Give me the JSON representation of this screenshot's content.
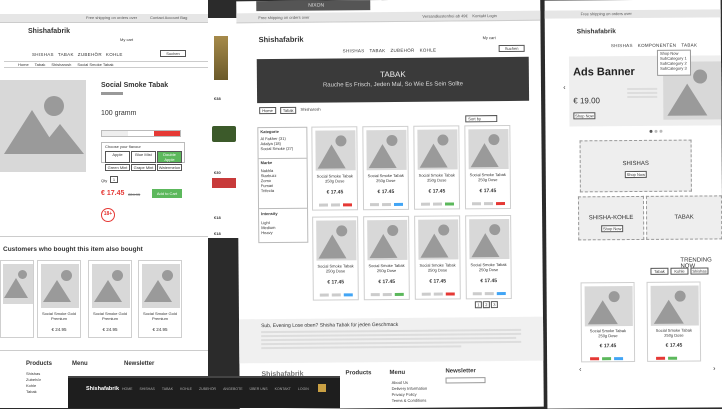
{
  "left": {
    "topbar_text": "Free shipping on orders over",
    "topbar_right": "Contact  Account  Bag",
    "logo": "Shishafabrik",
    "cart": "My cart",
    "nav": [
      "SHISHAS",
      "TABAK",
      "ZUBEHÖR",
      "KOHLE"
    ],
    "search_btn": "Suchen",
    "breadcrumbs": [
      "Home",
      "Tabak",
      "Shisharosh",
      "Social Smoke Tabak"
    ],
    "product_title": "Social Smoke Tabak",
    "weight": "100 gramm",
    "price": "€ 17.45",
    "old_price": "€24.95",
    "add_to_cart": "Add to Cart",
    "age": "18+",
    "qty_label": "Qty",
    "qty": "1",
    "flavour_label": "Choose your flavour",
    "flavours": [
      "Apple",
      "Blue Mist",
      "Double Apple",
      "Green Mint",
      "Grape Mint",
      "Watermelon"
    ],
    "customers_title": "Customers who bought this item also bought",
    "related": [
      {
        "name": "Social Smoke Gold Premium",
        "price": "€ 24.95"
      },
      {
        "name": "Social Smoke Gold Premium",
        "price": "€ 24.95"
      },
      {
        "name": "Social Smoke Gold Premium",
        "price": "€ 24.95"
      },
      {
        "name": "Social Smoke Gold Premium",
        "price": "€ 24.95"
      }
    ],
    "footer_products": "Products",
    "footer_menu": "Menu",
    "footer_newsletter": "Newsletter",
    "footer_links": [
      "Shishas",
      "Zubehör",
      "Kohle",
      "Tabak"
    ]
  },
  "strip": {
    "price_a": "€38",
    "price_b": "€30",
    "price_c": "€18",
    "price_d": "€18"
  },
  "middle": {
    "topbar_text": "Free shipping on orders over",
    "topbar_mid": "Versandkostenfrei ab 49€",
    "topbar_right": "Kontakt  Login",
    "dark_top": "NIXON",
    "logo": "Shishafabrik",
    "cart": "My cart",
    "nav": [
      "SHISHAS",
      "TABAK",
      "ZUBEHÖR",
      "KOHLE"
    ],
    "search_btn": "Suchen",
    "hero_title": "TABAK",
    "hero_sub": "Rauche Es Frisch, Jeden Mal, So Wie Es Sein Sollte",
    "breadcrumbs": [
      "Home",
      "Tabak",
      "Shisharosh"
    ],
    "sort": "Sort by",
    "filter_kategorie": "Kategorie",
    "filter_kat_items": [
      "Al Fakher (31)",
      "Adalya (18)",
      "Social Smoke (27)"
    ],
    "filter_marke": "Marke",
    "filter_marke_items": [
      "Nakhla",
      "Starbuzz",
      "Zomo",
      "Fumari",
      "Trifecta"
    ],
    "filter_intensity": "Intensity",
    "filter_int_items": [
      "Light",
      "Medium",
      "Heavy"
    ],
    "products": [
      {
        "name": "Social Smoke Tabak 250g Dose",
        "price": "€ 17.45"
      },
      {
        "name": "Social Smoke Tabak 250g Dose",
        "price": "€ 17.45"
      },
      {
        "name": "Social Smoke Tabak 250g Dose",
        "price": "€ 17.45"
      },
      {
        "name": "Social Smoke Tabak 250g Dose",
        "price": "€ 17.45"
      },
      {
        "name": "Social Smoke Tabak 250g Dose",
        "price": "€ 17.45"
      },
      {
        "name": "Social Smoke Tabak 250g Dose",
        "price": "€ 17.45"
      },
      {
        "name": "Social Smoke Tabak 250g Dose",
        "price": "€ 17.45"
      },
      {
        "name": "Social Smoke Tabak 250g Dose",
        "price": "€ 17.45"
      }
    ],
    "pages": [
      "1",
      "2",
      "3"
    ],
    "seo_title": "Sub, Evening Lose oben? Shisha Tabak für jeden Geschmack",
    "footer_logo": "Shishafabrik",
    "footer_products": "Products",
    "footer_menu": "Menu",
    "footer_newsletter": "Newsletter",
    "footer_menu_links": [
      "About Us",
      "Delivery Information",
      "Privacy Policy",
      "Terms & Conditions"
    ]
  },
  "right": {
    "topbar_text": "Free shipping on orders over",
    "logo": "Shishafabrik",
    "nav": [
      "SHISHAS",
      "KOMPONENTEN",
      "TABAK"
    ],
    "dropdown": [
      "Shop Now",
      "SubCategory 1",
      "SubCategory 2",
      "SubCategory 3"
    ],
    "banner_title": "Ads Banner",
    "banner_price": "€ 19.00",
    "banner_btn": "Shop Now",
    "tile1": "SHISHAS",
    "tile1_btn": "Shop Now",
    "tile2": "SHISHA-KOHLE",
    "tile2_btn": "Shop Now",
    "tile3": "TABAK",
    "trending": "TRENDING NOW",
    "tabs": [
      "Tabak",
      "Kohle",
      "Shishas"
    ],
    "products": [
      {
        "name": "Social Smoke Tabak 250g Dose",
        "price": "€ 17.45"
      },
      {
        "name": "Social Smoke Tabak 250g Dose",
        "price": "€ 17.45"
      }
    ]
  },
  "bottom_bar": {
    "logo": "Shishafabrik",
    "nav": [
      "HOME",
      "SHISHAS",
      "TABAK",
      "KOHLE",
      "ZUBEHÖR",
      "ANGEBOTE",
      "ÜBER UNS",
      "KONTAKT",
      "LOGIN"
    ]
  }
}
